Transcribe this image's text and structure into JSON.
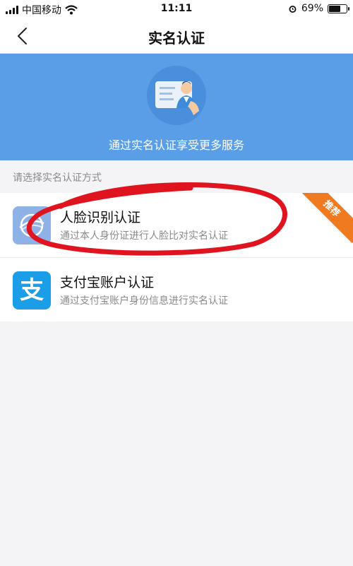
{
  "status_bar": {
    "carrier": "中国移动",
    "time": "11:11",
    "battery_percent": "69%",
    "battery_level": 0.69,
    "icons": [
      "signal-icon",
      "wifi-icon",
      "alarm-icon",
      "battery-icon"
    ]
  },
  "nav": {
    "title": "实名认证",
    "back_icon": "chevron-left-icon"
  },
  "banner": {
    "text": "通过实名认证享受更多服务",
    "icon": "id-card-person-icon",
    "color": "#5a9ee8"
  },
  "section_label": "请选择实名认证方式",
  "methods": [
    {
      "title": "人脸识别认证",
      "description": "通过本人身份证进行人脸比对实名认证",
      "icon": "face-scan-icon",
      "badge": "推荐",
      "badge_color": "#f07a1f"
    },
    {
      "title": "支付宝账户认证",
      "description": "通过支付宝账户身份信息进行实名认证",
      "icon": "alipay-icon",
      "icon_glyph": "支",
      "icon_color": "#1b9de8"
    }
  ],
  "annotation_color": "#e0141e"
}
